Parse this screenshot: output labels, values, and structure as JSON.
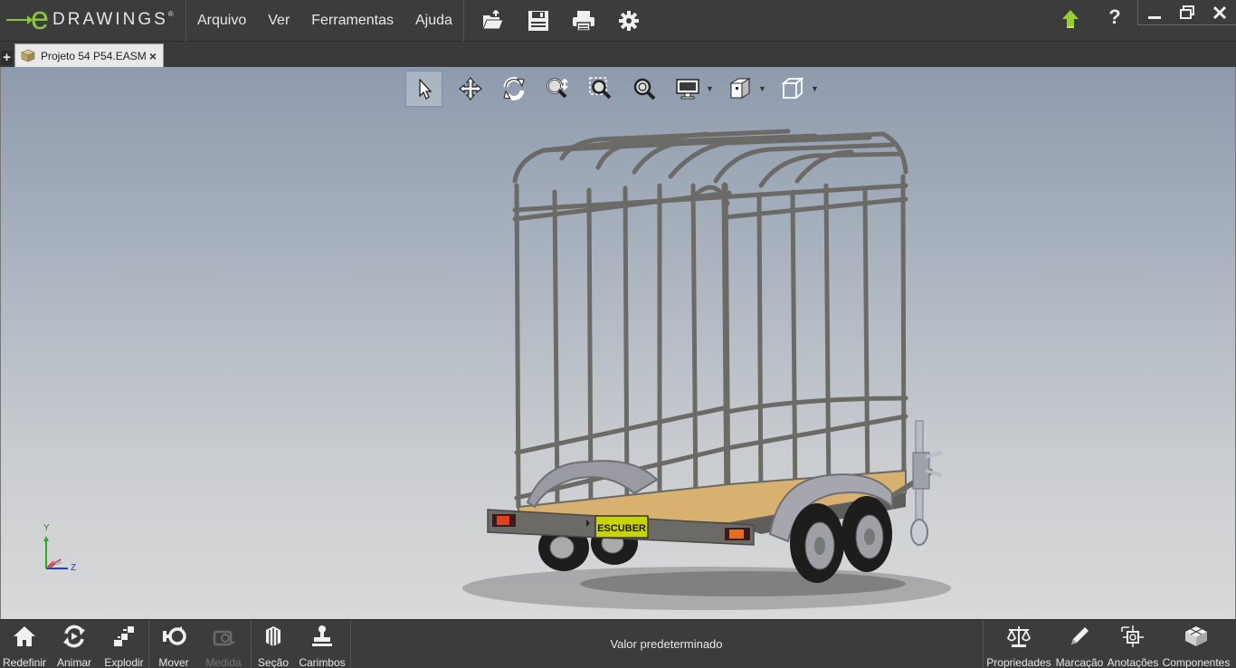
{
  "app": {
    "brand_letter": "e",
    "brand_word": "DRAWINGS",
    "brand_mark": "®"
  },
  "menu": {
    "items": [
      "Arquivo",
      "Ver",
      "Ferramentas",
      "Ajuda"
    ]
  },
  "file_tools": [
    {
      "icon": "open-folder-icon"
    },
    {
      "icon": "save-icon"
    },
    {
      "icon": "print-icon"
    },
    {
      "icon": "settings-gear-icon"
    }
  ],
  "right_controls": {
    "help_label": "?"
  },
  "tab": {
    "new_tab_label": "+",
    "document_name": "Projeto 54 P54.EASM",
    "close_label": "×"
  },
  "view_toolbar": [
    {
      "icon": "select-arrow-icon",
      "active": true
    },
    {
      "icon": "pan-icon"
    },
    {
      "icon": "rotate-icon"
    },
    {
      "icon": "zoom-icon"
    },
    {
      "icon": "zoom-to-area-icon"
    },
    {
      "icon": "zoom-to-fit-icon"
    },
    {
      "icon": "display-monitor-icon",
      "dropdown": true
    },
    {
      "icon": "display-style-icon",
      "dropdown": true
    },
    {
      "icon": "standard-views-cube-icon",
      "dropdown": true
    }
  ],
  "model": {
    "plate_text": "ESCUBER"
  },
  "triad": {
    "y_label": "Y",
    "z_label": "Z"
  },
  "bottom_left": [
    {
      "label": "Redefinir",
      "icon": "home-icon"
    },
    {
      "label": "Animar",
      "icon": "animate-icon"
    },
    {
      "label": "Explodir",
      "icon": "explode-icon"
    },
    {
      "label": "Mover",
      "icon": "move-component-icon"
    },
    {
      "label": "Medida",
      "icon": "measure-icon",
      "disabled": true
    },
    {
      "label": "Seção",
      "icon": "section-icon"
    },
    {
      "label": "Carimbos",
      "icon": "stamp-icon"
    }
  ],
  "status_text": "Valor predeterminado",
  "bottom_right": [
    {
      "label": "Propriedades",
      "icon": "properties-scale-icon"
    },
    {
      "label": "Marcação",
      "icon": "markup-pencil-icon"
    },
    {
      "label": "Anotações",
      "icon": "annotations-icon"
    },
    {
      "label": "Componentes",
      "icon": "components-icon"
    }
  ],
  "colors": {
    "brand_green": "#8cc63f",
    "chrome_dark": "#3c3c3c",
    "frame_gray": "#6b6a66",
    "deck_wood": "#d8b070",
    "plate_yellow": "#c8d400"
  }
}
